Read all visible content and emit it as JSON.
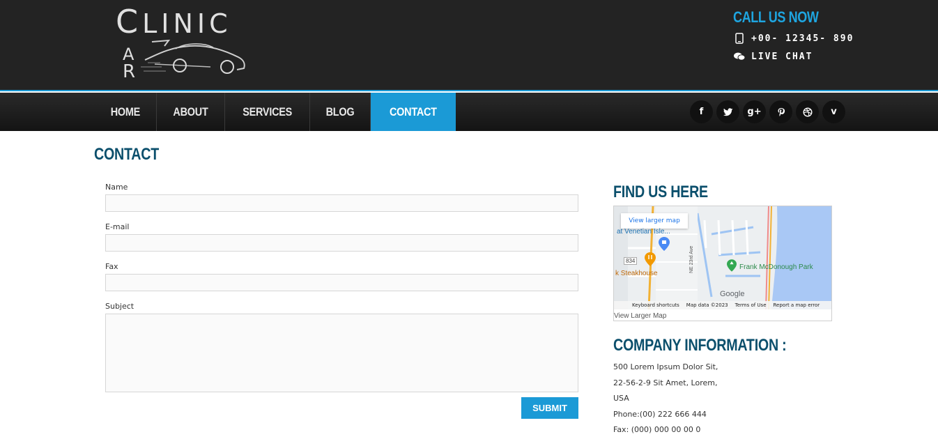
{
  "logo": {
    "line1_cap": "C",
    "line1_rest": "LINIC",
    "letter_c": "C",
    "letter_a": "A",
    "letter_r": "R"
  },
  "callus": {
    "title": "CALL US NOW",
    "phone": "+00- 12345- 890",
    "chat": "LIVE CHAT"
  },
  "nav": {
    "items": [
      {
        "label": "HOME"
      },
      {
        "label": "ABOUT"
      },
      {
        "label": "SERVICES"
      },
      {
        "label": "BLOG"
      },
      {
        "label": "CONTACT",
        "active": true
      }
    ]
  },
  "social": [
    {
      "icon": "facebook-icon",
      "glyph": "f"
    },
    {
      "icon": "twitter-icon",
      "glyph": "t"
    },
    {
      "icon": "google-plus-icon",
      "glyph": "g+"
    },
    {
      "icon": "pinterest-icon",
      "glyph": "p"
    },
    {
      "icon": "dribbble-icon",
      "glyph": "◎"
    },
    {
      "icon": "vimeo-icon",
      "glyph": "v"
    }
  ],
  "page": {
    "title": "CONTACT"
  },
  "form": {
    "name_label": "Name",
    "email_label": "E-mail",
    "fax_label": "Fax",
    "subject_label": "Subject",
    "submit_label": "SUBMIT"
  },
  "map": {
    "heading": "FIND US HERE",
    "larger_button": "View larger map",
    "place1": "at Venetian Isle...",
    "place2": "k Steakhouse",
    "place3": "Frank McDonough Park",
    "road": "834",
    "street": "NE 23rd Ave",
    "google": "Google",
    "attrib_shortcuts": "Keyboard shortcuts",
    "attrib_data": "Map data ©2023",
    "attrib_terms": "Terms of Use",
    "attrib_report": "Report a map error",
    "view_link": "View Larger Map"
  },
  "company": {
    "heading": "COMPANY INFORMATION :",
    "line1": "500 Lorem Ipsum Dolor Sit,",
    "line2": "22-56-2-9 Sit Amet, Lorem,",
    "line3": "USA",
    "phone": "Phone:(00) 222 666 444",
    "fax": "Fax: (000) 000 00 00 0"
  },
  "colors": {
    "accent": "#1b9ad6",
    "heading": "#0b4f6c",
    "header_bg": "#232323"
  }
}
